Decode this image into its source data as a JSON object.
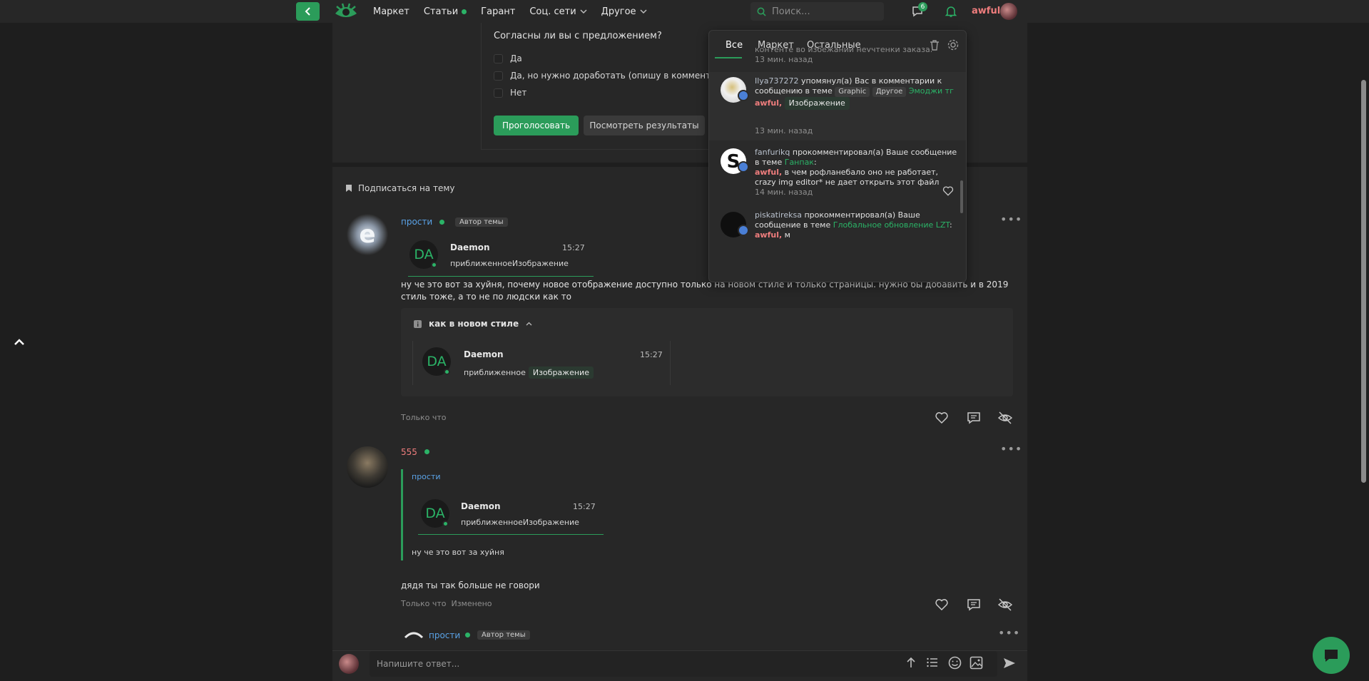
{
  "topbar": {
    "nav": [
      "Маркет",
      "Статьи",
      "Гарант",
      "Соц. сети",
      "Другое"
    ],
    "search_placeholder": "Поиск...",
    "messages_badge": "6",
    "username": "awful"
  },
  "poll": {
    "question": "Согласны ли вы с предложением?",
    "options": [
      "Да",
      "Да, но нужно доработать (опишу в комментария",
      "Нет"
    ],
    "vote_button": "Проголосовать",
    "results_button": "Посмотреть результаты"
  },
  "thread": {
    "subscribe": "Подписаться на тему"
  },
  "post1": {
    "author": "прости",
    "author_tag": "Автор темы",
    "quote": {
      "initials": "DA",
      "name": "Daemon",
      "time": "15:27",
      "text": "приближенноеИзображение"
    },
    "body": "ну че это вот за хуйня, почему новое отображение доступно только на новом стиле и только страницы. нужно бы добавить и в 2019 стиль тоже, а то не по людски как то",
    "spoiler_title": "как в новом стиле",
    "spoiler_quote": {
      "initials": "DA",
      "name": "Daemon",
      "time": "15:27",
      "text": "приближенное",
      "chip": "Изображение"
    },
    "time": "Только что"
  },
  "post2": {
    "author": "555",
    "quoted_user": "прости",
    "quote": {
      "initials": "DA",
      "name": "Daemon",
      "time": "15:27",
      "text": "приближенноеИзображение"
    },
    "quoted_text": "ну че это вот за хуйня",
    "body": "дядя ты так больше не говори",
    "time": "Только что",
    "edited": "Изменено"
  },
  "post3": {
    "author": "прости",
    "author_tag": "Автор темы"
  },
  "reply": {
    "placeholder": "Напишите ответ..."
  },
  "notifications": {
    "tabs": [
      "Все",
      "Маркет",
      "Остальные"
    ],
    "first_partial_text": "контенте во избежании неучтенки заказа.",
    "first_time": "13 мин. назад",
    "items": [
      {
        "user": "Ilya737272",
        "action": "упомянул(а) Вас в комментарии к сообщению в теме",
        "tags": [
          "Graphic",
          "Другое"
        ],
        "thread": "Эмоджи тг",
        "mention": "awful,",
        "chip": "Изображение",
        "time": "13 мин. назад"
      },
      {
        "user": "fanfurikq",
        "action": "прокомментировал(а) Ваше сообщение в теме",
        "thread": "Ганпак",
        "mention": "awful,",
        "text": "в чем рофланебало оно не работает, crazy img editor* не дает открыть этот файл",
        "time": "14 мин. назад"
      },
      {
        "user": "piskatireksa",
        "action": "прокомментировал(а) Ваше сообщение в теме",
        "thread": "Глобальное обновление LZT",
        "mention": "awful,",
        "text": "м"
      }
    ]
  },
  "colors": {
    "accent": "#2b9c5a",
    "username_red": "#ef7d7d",
    "username_blue": "#5aa2e6"
  }
}
